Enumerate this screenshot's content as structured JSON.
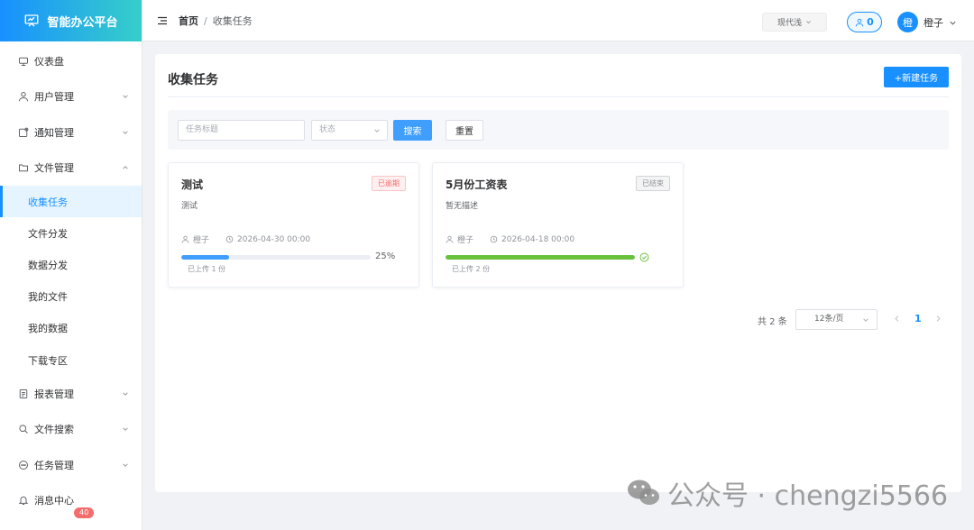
{
  "app": {
    "title": "智能办公平台"
  },
  "sidebar": {
    "items": [
      {
        "label": "仪表盘",
        "icon": "dashboard-icon",
        "has_arrow": false
      },
      {
        "label": "用户管理",
        "icon": "user-icon",
        "has_arrow": true
      },
      {
        "label": "通知管理",
        "icon": "notice-icon",
        "has_arrow": true
      },
      {
        "label": "文件管理",
        "icon": "folder-icon",
        "has_arrow": true,
        "expanded": true
      }
    ],
    "sub_items": [
      {
        "label": "收集任务",
        "active": true
      },
      {
        "label": "文件分发",
        "active": false
      },
      {
        "label": "数据分发",
        "active": false
      },
      {
        "label": "我的文件",
        "active": false
      },
      {
        "label": "我的数据",
        "active": false
      },
      {
        "label": "下载专区",
        "active": false
      }
    ],
    "items_after": [
      {
        "label": "报表管理",
        "icon": "report-icon",
        "has_arrow": true
      },
      {
        "label": "文件搜索",
        "icon": "search-icon",
        "has_arrow": true
      },
      {
        "label": "任务管理",
        "icon": "chat-icon",
        "has_arrow": true
      },
      {
        "label": "消息中心",
        "icon": "bell-icon",
        "has_arrow": false,
        "badge": "40"
      }
    ]
  },
  "header": {
    "breadcrumb_home": "首页",
    "breadcrumb_sep": "/",
    "breadcrumb_current": "收集任务",
    "theme": "现代浅",
    "user_count": "0",
    "avatar_char": "橙",
    "username": "橙子"
  },
  "main": {
    "title": "收集任务",
    "new_button": "+新建任务",
    "search": {
      "title_placeholder": "任务标题",
      "status_placeholder": "状态",
      "search_button": "搜索",
      "reset_button": "重置"
    },
    "cards": [
      {
        "title": "测试",
        "tag": "已逾期",
        "tag_style": "red",
        "desc": "测试",
        "owner": "橙子",
        "time": "2026-04-30 00:00",
        "progress": 25,
        "progress_text": "25%",
        "progress_color": "#409eff",
        "completed": false,
        "uploaded": "已上传 1 份"
      },
      {
        "title": "5月份工资表",
        "tag": "已结束",
        "tag_style": "gray",
        "desc": "暂无描述",
        "owner": "橙子",
        "time": "2026-04-18 00:00",
        "progress": 100,
        "progress_text": "",
        "progress_color": "#67c23a",
        "completed": true,
        "uploaded": "已上传 2 份"
      }
    ],
    "pagination": {
      "total": "共 2 条",
      "page_size": "12条/页",
      "current": "1"
    }
  },
  "watermark": {
    "text": "公众号 · chengzi5566"
  },
  "colors": {
    "primary": "#1890ff",
    "danger": "#f56c6c",
    "success": "#67c23a"
  }
}
